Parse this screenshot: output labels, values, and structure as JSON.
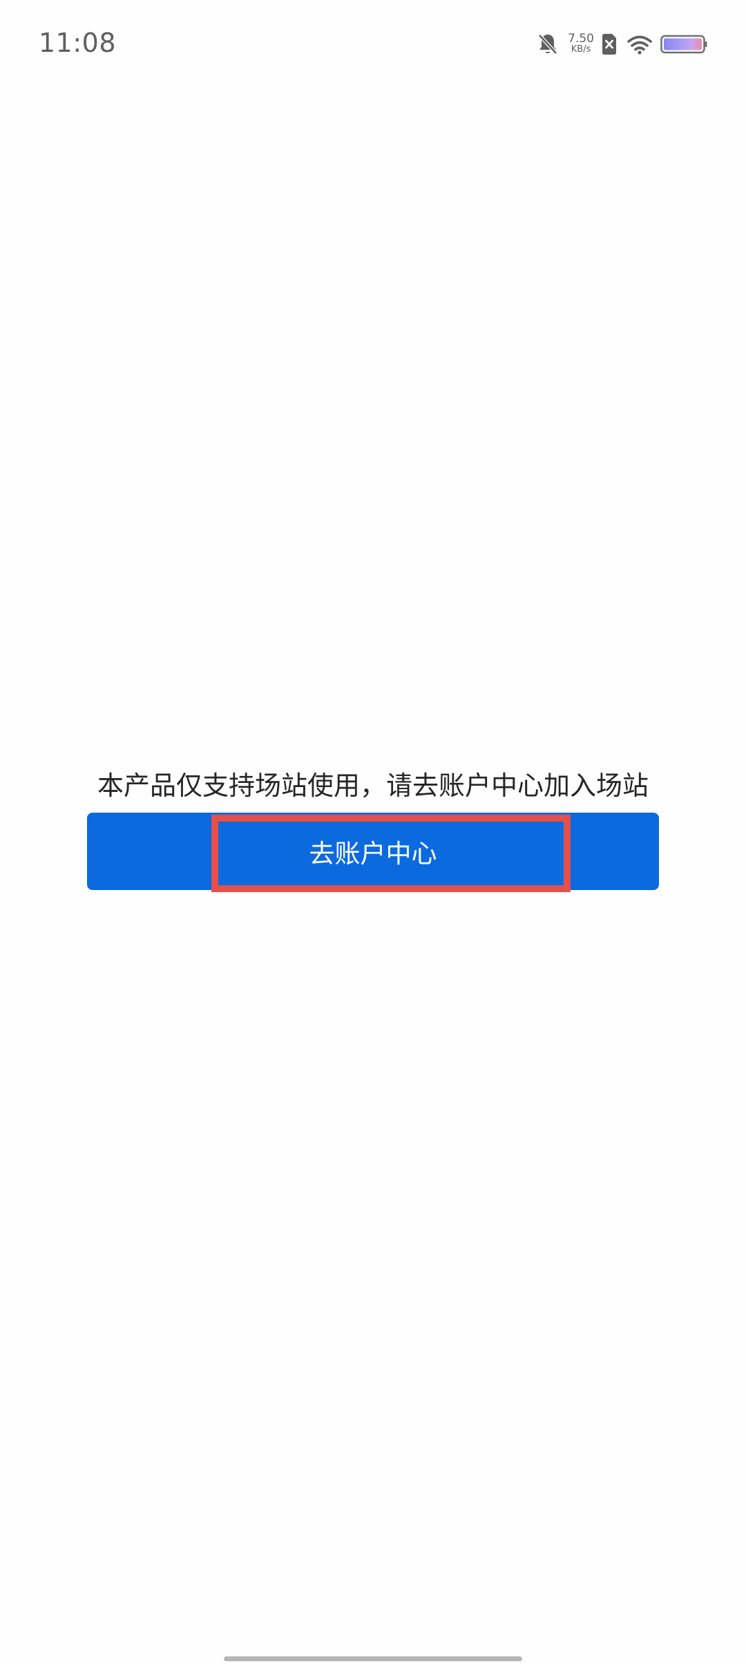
{
  "status_bar": {
    "time": "11:08",
    "network_speed_value": "7.50",
    "network_speed_unit": "KB/s",
    "icons": [
      "bell-muted-icon",
      "no-sim-icon",
      "wifi-icon",
      "battery-icon"
    ]
  },
  "main": {
    "message": "本产品仅支持场站使用，请去账户中心加入场站",
    "button_label": "去账户中心"
  },
  "colors": {
    "primary": "#0c6adf",
    "highlight": "#e4504c",
    "text": "#262626",
    "status_text": "#5f5f5f"
  }
}
